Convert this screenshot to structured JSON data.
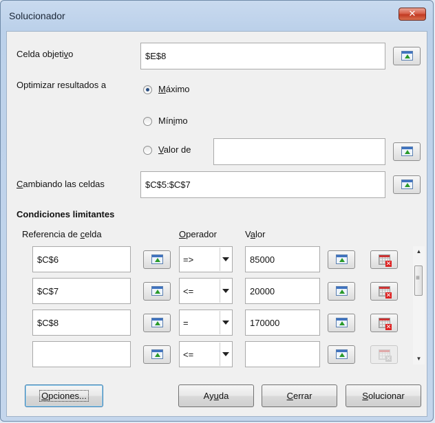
{
  "window": {
    "title": "Solucionador",
    "close_label": "✕"
  },
  "target": {
    "label_pre": "Celda objeti",
    "label_key": "v",
    "label_post": "o",
    "value": "$E$8"
  },
  "optimize": {
    "label": "Optimizar resultados a",
    "max": {
      "key": "M",
      "rest": "áximo",
      "selected": true
    },
    "min": {
      "pre": "Mín",
      "key": "i",
      "post": "mo",
      "selected": false
    },
    "value": {
      "key": "V",
      "rest": "alor de",
      "selected": false,
      "input": ""
    }
  },
  "changing": {
    "label_key": "C",
    "label_rest": "ambiando las celdas",
    "value": "$C$5:$C$7"
  },
  "constraints": {
    "heading": "Condiciones limitantes",
    "col_ref": {
      "pre": "Referencia de ",
      "key": "c",
      "post": "elda"
    },
    "col_op": {
      "key": "O",
      "rest": "perador"
    },
    "col_val": {
      "pre": "V",
      "key": "a",
      "post": "lor"
    },
    "rows": [
      {
        "ref": "$C$6",
        "op": "=>",
        "val": "85000"
      },
      {
        "ref": "$C$7",
        "op": "<=",
        "val": "20000"
      },
      {
        "ref": "$C$8",
        "op": "=",
        "val": "170000"
      },
      {
        "ref": "",
        "op": "<=",
        "val": ""
      }
    ]
  },
  "buttons": {
    "options": {
      "key": "O",
      "rest": "pciones..."
    },
    "help": {
      "pre": "Ay",
      "key": "u",
      "post": "da"
    },
    "close": {
      "key": "C",
      "rest": "errar"
    },
    "solve": {
      "key": "S",
      "rest": "olucionar"
    }
  },
  "icons": {
    "shrink": "shrink-ref-icon",
    "delete": "delete-row-icon",
    "scroll_up": "▲",
    "scroll_down": "▼"
  },
  "colors": {
    "titlebar": "#c4d6ec",
    "close_button": "#c23a22",
    "radio_dot": "#2a4f83"
  }
}
